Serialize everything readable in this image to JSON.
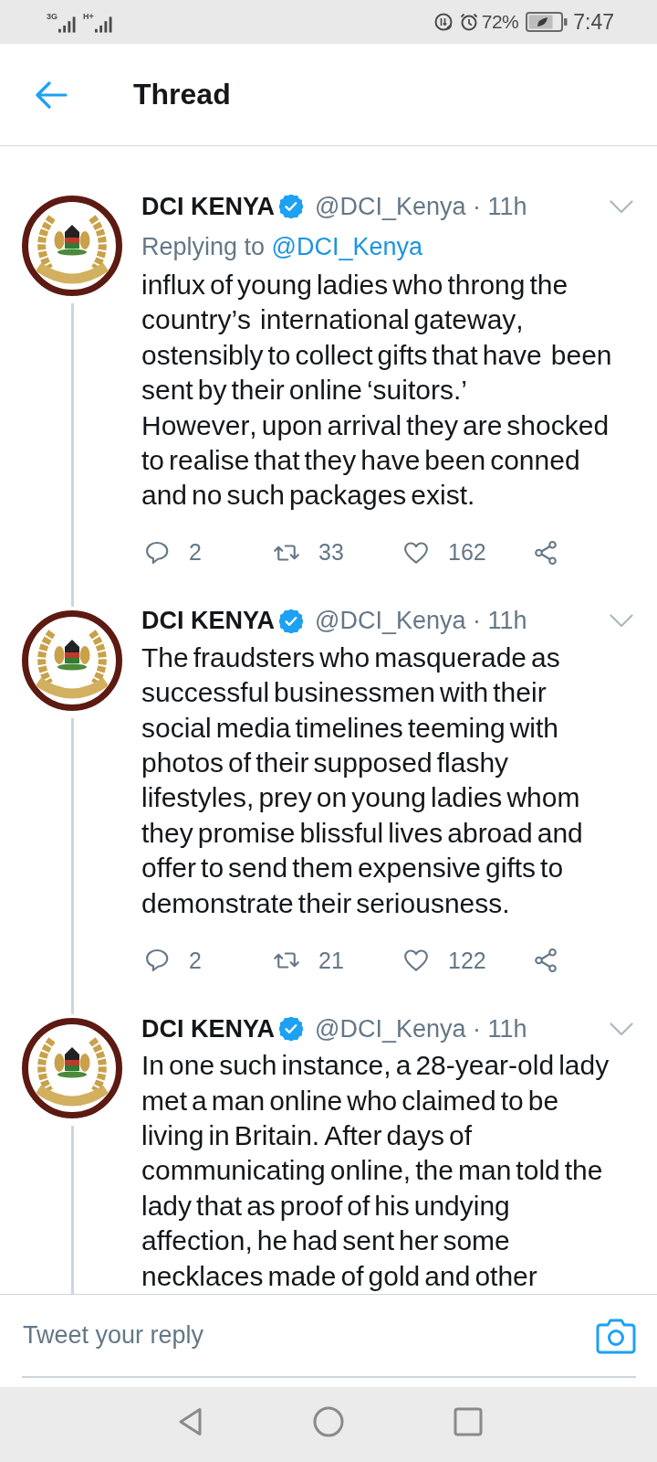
{
  "status_bar": {
    "networks": [
      {
        "label": "3G"
      },
      {
        "label": "H+"
      }
    ],
    "battery": "72%",
    "time": "7:47"
  },
  "header": {
    "title": "Thread"
  },
  "tweets": [
    {
      "name": "DCI KENYA",
      "verified": true,
      "byline": "@DCI_Kenya · 11h",
      "replying_to": {
        "label": "Replying to",
        "mention": "@DCI_Kenya"
      },
      "text": "influx of young ladies who throng the country’s  international gateway, ostensibly to collect gifts that have  been sent by their online ‘suitors.’\nHowever, upon arrival they are shocked to realise that they have been conned and no such packages exist.",
      "actions": [
        {
          "kind": "reply",
          "count": "2"
        },
        {
          "kind": "retweet",
          "count": "33"
        },
        {
          "kind": "like",
          "count": "162"
        },
        {
          "kind": "share"
        }
      ]
    },
    {
      "name": "DCI KENYA",
      "verified": true,
      "byline": "@DCI_Kenya · 11h",
      "text": "The fraudsters who masquerade as successful businessmen with their social media timelines teeming with photos of their supposed flashy lifestyles, prey on young ladies whom they promise blissful lives abroad and offer to send them expensive gifts to demonstrate their seriousness.",
      "actions": [
        {
          "kind": "reply",
          "count": "2"
        },
        {
          "kind": "retweet",
          "count": "21"
        },
        {
          "kind": "like",
          "count": "122"
        },
        {
          "kind": "share"
        }
      ]
    },
    {
      "name": "DCI KENYA",
      "verified": true,
      "byline": "@DCI_Kenya · 11h",
      "text": "In one such instance, a 28-year-old lady met a man online who claimed to be living in Britain. After days of communicating online, the man told the lady that as proof of his undying affection, he had sent her some necklaces made of gold and other"
    }
  ],
  "reply_bar": {
    "placeholder": "Tweet your reply"
  }
}
